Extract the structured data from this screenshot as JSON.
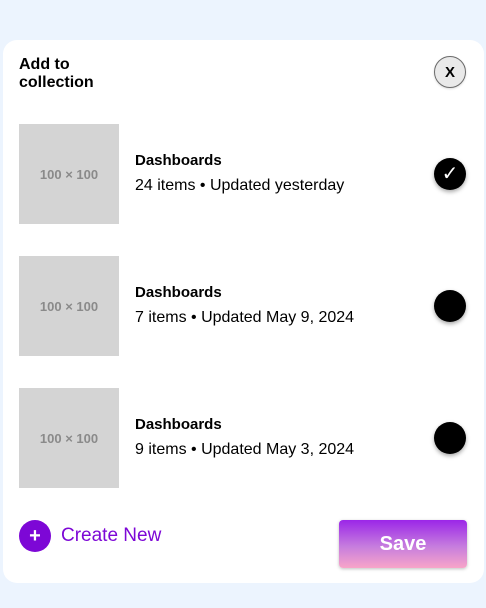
{
  "dialog": {
    "title": "Add to collection",
    "close_label": "X"
  },
  "collections": [
    {
      "name": "Dashboards",
      "meta": "24 items • Updated yesterday",
      "thumbnail_label": "100 × 100",
      "selected": true,
      "check_glyph": "✓"
    },
    {
      "name": "Dashboards",
      "meta": "7 items • Updated May 9, 2024",
      "thumbnail_label": "100 × 100",
      "selected": false,
      "check_glyph": ""
    },
    {
      "name": "Dashboards",
      "meta": "9 items • Updated May 3, 2024",
      "thumbnail_label": "100 × 100",
      "selected": false,
      "check_glyph": ""
    }
  ],
  "footer": {
    "create_new_label": "Create New",
    "plus_icon": "+",
    "save_label": "Save"
  },
  "colors": {
    "accent": "#7d07d6",
    "background": "#ecf4fe",
    "save_gradient_top": "#9b26e8",
    "save_gradient_bottom": "#f8a5c9"
  }
}
